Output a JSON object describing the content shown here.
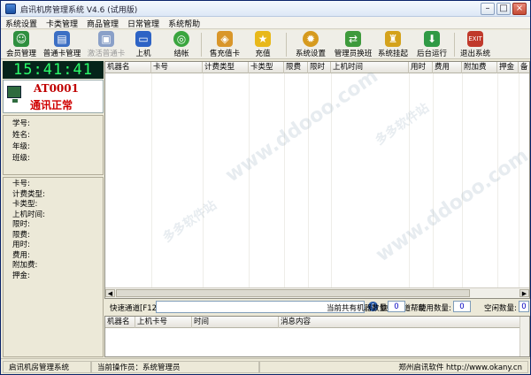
{
  "window": {
    "title": "启讯机房管理系统  V4.6 (试用版)"
  },
  "menu": [
    "系统设置",
    "卡类管理",
    "商品管理",
    "日常管理",
    "系统帮助"
  ],
  "toolbar": [
    {
      "label": "会员管理",
      "icon": "members-icon",
      "color": "#2f8f3f"
    },
    {
      "label": "普通卡管理",
      "icon": "card-manage-icon",
      "color": "#3c6fc4"
    },
    {
      "label": "激活普通卡",
      "icon": "activate-card-icon",
      "color": "#8aa0c8",
      "disabled": true
    },
    {
      "label": "上机",
      "icon": "computer-icon",
      "color": "#2d63c5"
    },
    {
      "label": "结帐",
      "icon": "checkout-icon",
      "color": "#3aa53f"
    },
    {
      "label": "售充值卡",
      "icon": "sell-card-icon",
      "color": "#d9962a"
    },
    {
      "label": "充值",
      "icon": "recharge-icon",
      "color": "#e8b81a"
    },
    {
      "label": "系统设置",
      "icon": "settings-icon",
      "color": "#d69a1e"
    },
    {
      "label": "管理员换班",
      "icon": "shift-change-icon",
      "color": "#3e9a3c"
    },
    {
      "label": "系统挂起",
      "icon": "lock-icon",
      "color": "#d4a21c"
    },
    {
      "label": "后台运行",
      "icon": "background-run-icon",
      "color": "#2f9a45"
    },
    {
      "label": "退出系统",
      "icon": "exit-icon",
      "color": "#c0392b"
    }
  ],
  "clock": "15:41:41",
  "station": {
    "id": "AT0001",
    "status": "通讯正常"
  },
  "student_info": [
    "学号:",
    "姓名:",
    "年级:",
    "班级:"
  ],
  "card_info": [
    "卡号:",
    "计费类型:",
    "卡类型:",
    "上机时间:",
    "限时:",
    "限费:",
    "用时:",
    "费用:",
    "附加费:",
    "押金:"
  ],
  "grid": {
    "columns": [
      "机器名",
      "卡号",
      "计费类型",
      "卡类型",
      "限费",
      "限时",
      "上机时间",
      "用时",
      "费用",
      "附加费",
      "押金",
      "备"
    ]
  },
  "quick": {
    "label": "快速通道[F12]",
    "placeholder": "",
    "help": "快速通道帮助",
    "total_label": "当前共有机器数量:",
    "total_value": "0",
    "used_label": "使用数量:",
    "used_value": "0",
    "idle_label": "空闲数量:",
    "idle_value": "0"
  },
  "messages": {
    "columns": [
      "机器名",
      "上机卡号",
      "时间",
      "消息内容"
    ]
  },
  "status": {
    "app": "启讯机房管理系统",
    "operator": "当前操作员：系统管理员",
    "vendor": "郑州启讯软件  http://www.okany.cn"
  },
  "watermarks": [
    "www.ddooo.com",
    "多多软件站"
  ]
}
